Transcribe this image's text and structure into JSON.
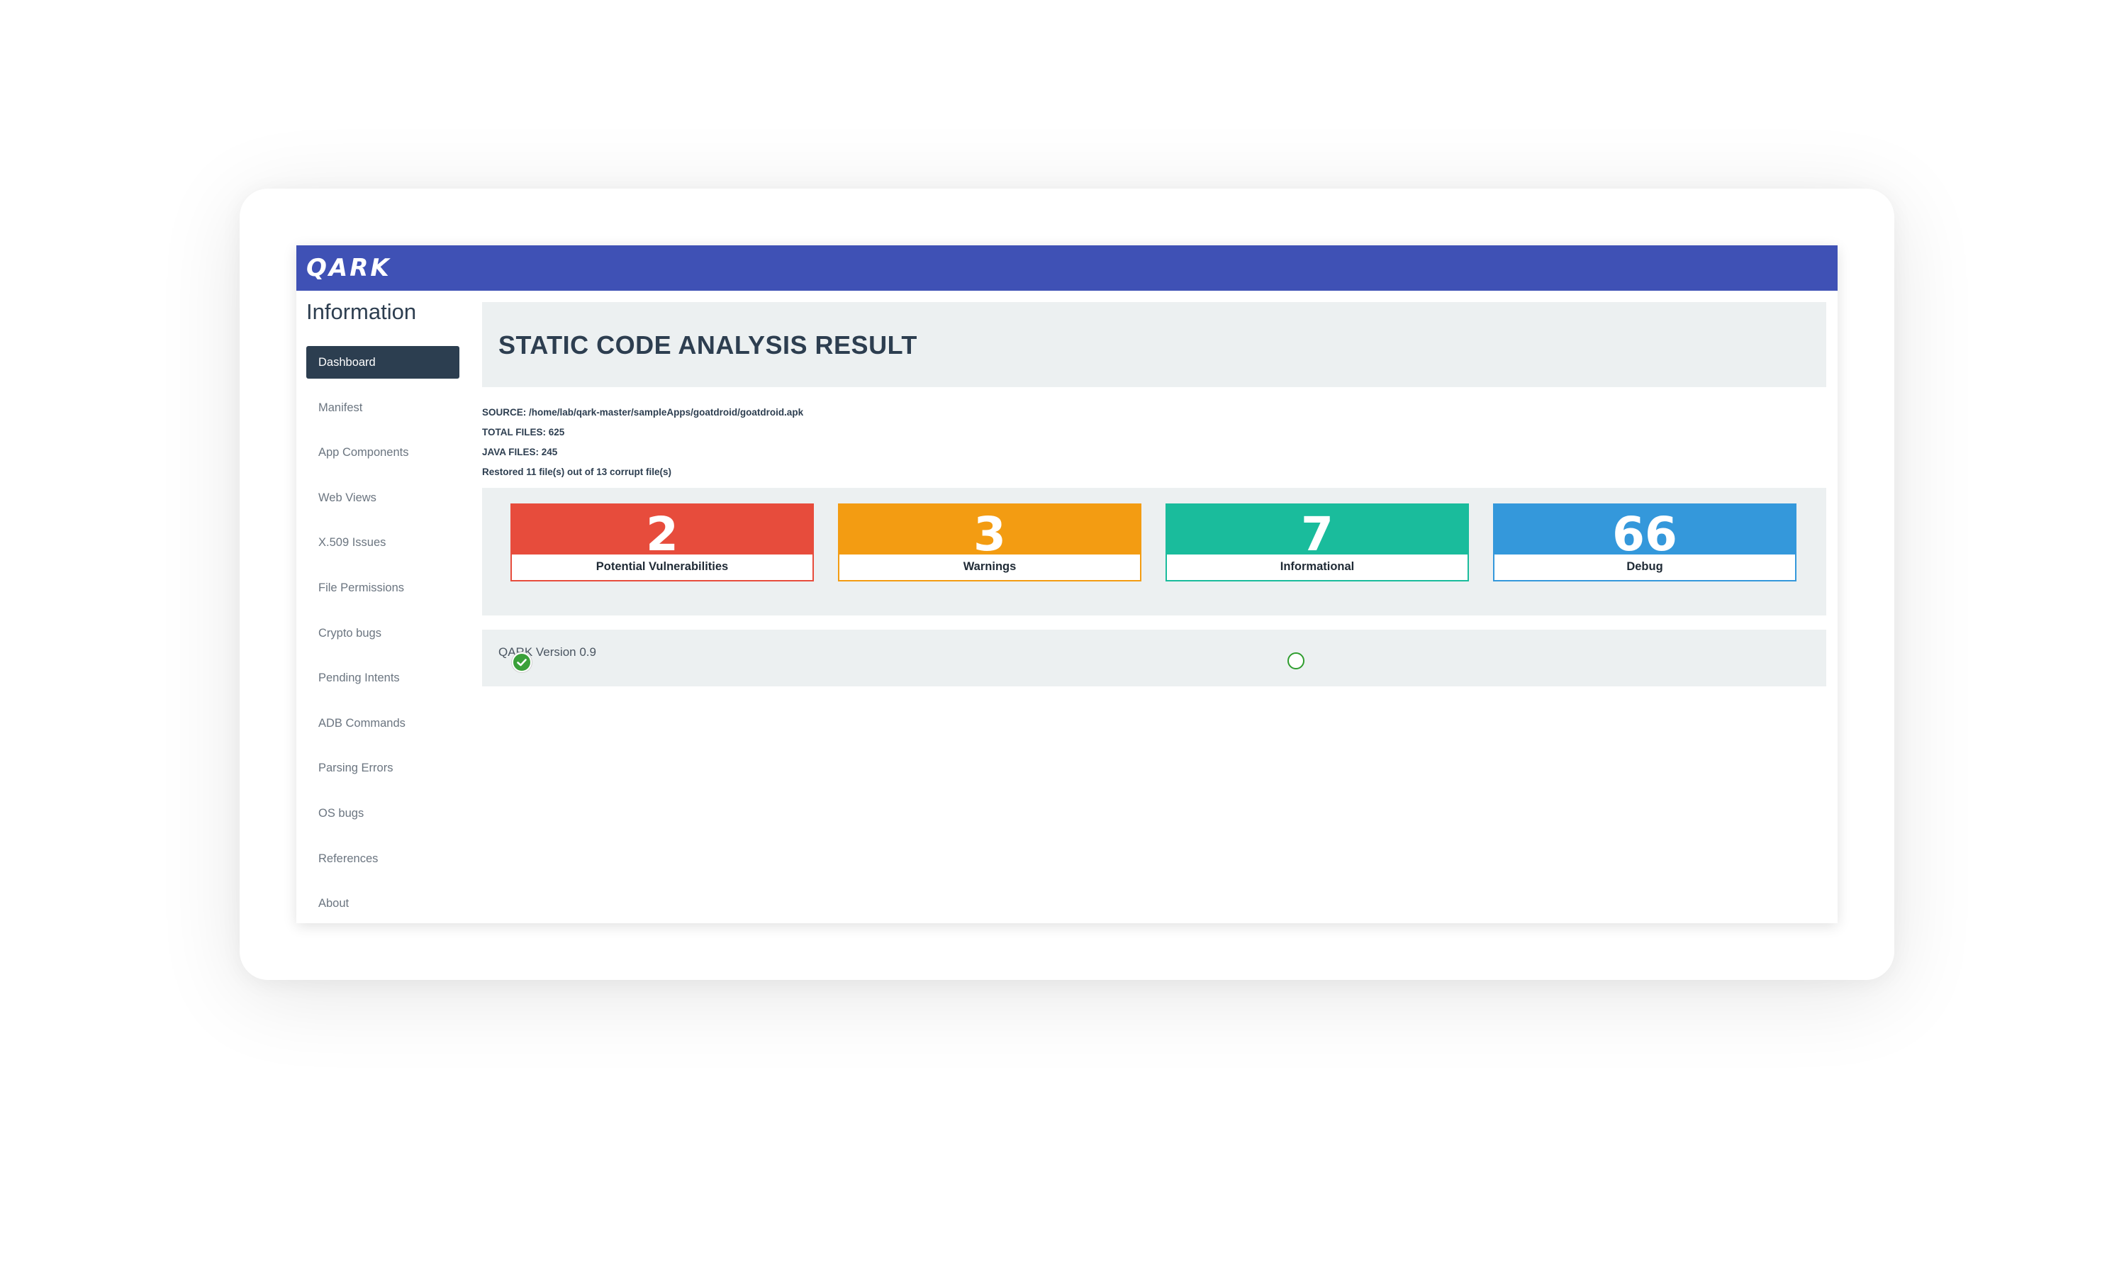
{
  "app": {
    "logo": "QARK"
  },
  "sidebar": {
    "title": "Information",
    "items": [
      {
        "label": "Dashboard",
        "active": true
      },
      {
        "label": "Manifest"
      },
      {
        "label": "App Components"
      },
      {
        "label": "Web Views"
      },
      {
        "label": "X.509 Issues"
      },
      {
        "label": "File Permissions"
      },
      {
        "label": "Crypto bugs"
      },
      {
        "label": "Pending Intents"
      },
      {
        "label": "ADB Commands"
      },
      {
        "label": "Parsing Errors"
      },
      {
        "label": "OS bugs"
      },
      {
        "label": "References"
      },
      {
        "label": "About"
      }
    ]
  },
  "main": {
    "title": "STATIC CODE ANALYSIS RESULT",
    "info": [
      "SOURCE: /home/lab/qark-master/sampleApps/goatdroid/goatdroid.apk",
      "TOTAL FILES: 625",
      "JAVA FILES: 245",
      "Restored 11 file(s) out of 13 corrupt file(s)"
    ],
    "stats": [
      {
        "count": "2",
        "label": "Potential Vulnerabilities",
        "color": "#e74c3c"
      },
      {
        "count": "3",
        "label": "Warnings",
        "color": "#f39c12"
      },
      {
        "count": "7",
        "label": "Informational",
        "color": "#1abc9c"
      },
      {
        "count": "66",
        "label": "Debug",
        "color": "#3498db"
      }
    ],
    "version": "QARK Version 0.9"
  },
  "icons": {
    "check": "check-circle-icon",
    "status": "circle-outline-icon"
  }
}
